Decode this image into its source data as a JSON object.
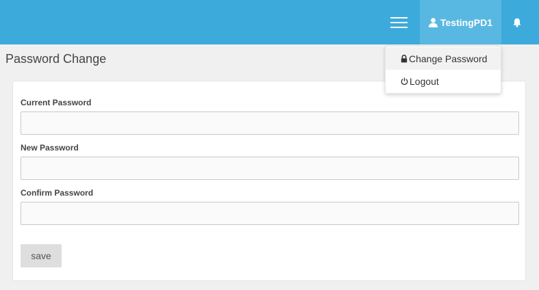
{
  "header": {
    "user_name": "TestingPD1",
    "background_color": "#3cabdb",
    "user_menu_color": "#59b8e2",
    "icons": [
      "hamburger-menu-icon",
      "user-icon",
      "bell-icon"
    ]
  },
  "page": {
    "title": "Password Change"
  },
  "form": {
    "current_password": {
      "label": "Current Password",
      "value": "",
      "placeholder": ""
    },
    "new_password": {
      "label": "New Password",
      "value": "",
      "placeholder": ""
    },
    "confirm_password": {
      "label": "Confirm Password",
      "value": "",
      "placeholder": ""
    },
    "save_label": "save"
  },
  "user_dropdown": {
    "items": [
      {
        "label": "Change Password",
        "icon": "lock-icon",
        "active": true
      },
      {
        "label": "Logout",
        "icon": "power-icon",
        "active": false
      }
    ]
  }
}
